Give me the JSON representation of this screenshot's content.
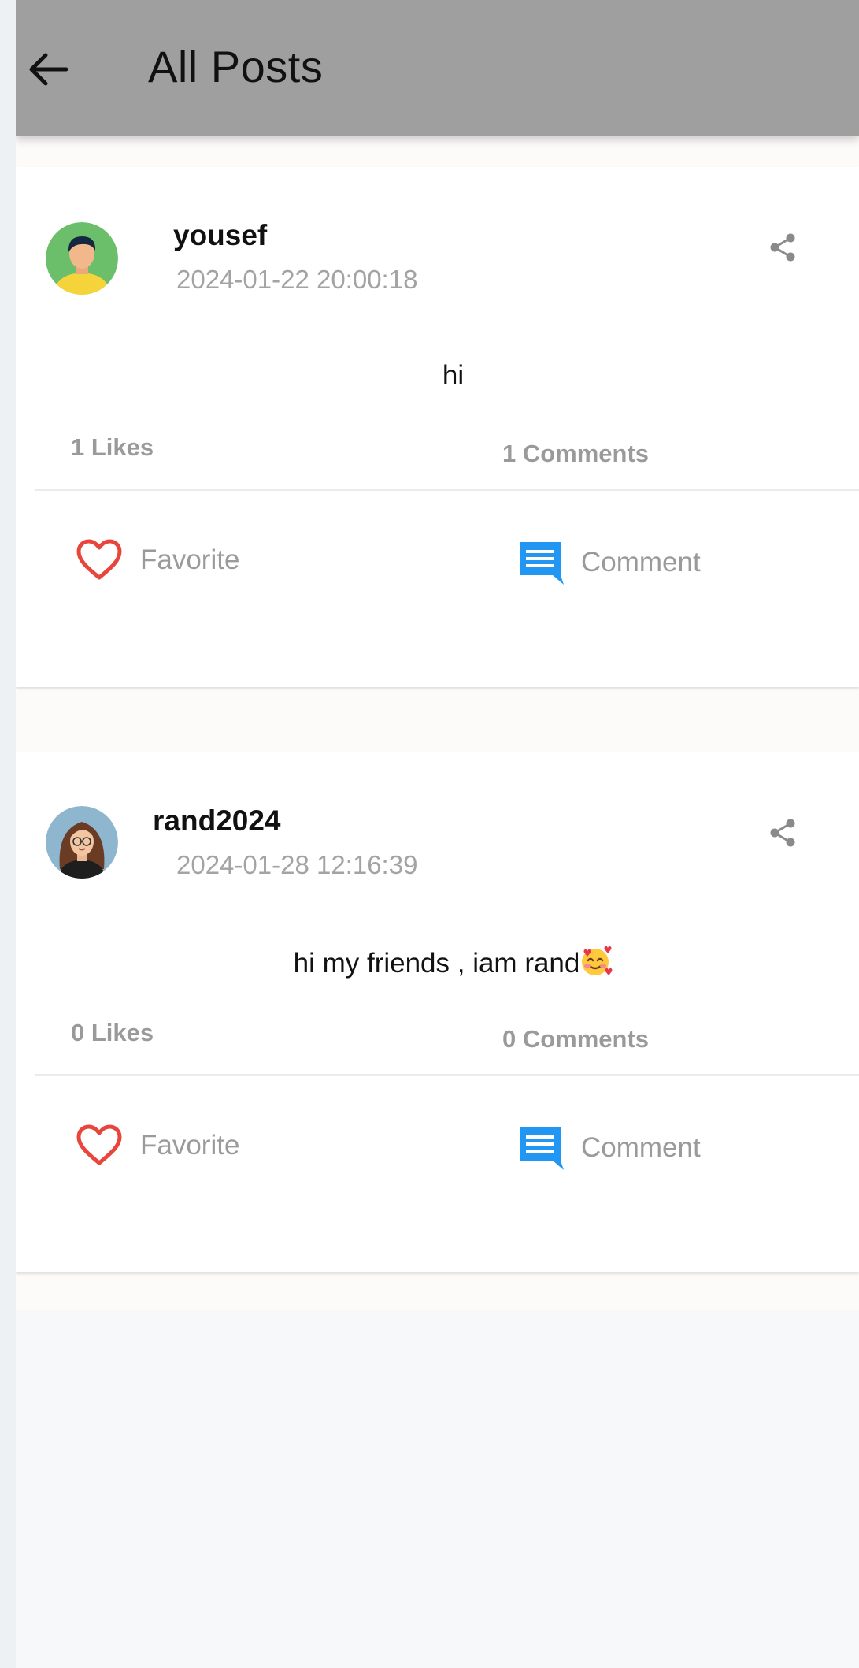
{
  "app_bar": {
    "title": "All Posts",
    "back_icon": "arrow-left-icon",
    "background": "#9f9f9f"
  },
  "posts": [
    {
      "username": "yousef",
      "timestamp": "2024-01-22 20:00:18",
      "text": "hi",
      "likes_label": "1 Likes",
      "comments_label": "1 Comments",
      "favorite_label": "Favorite",
      "comment_label": "Comment",
      "avatar_icon": "male-avatar-icon",
      "share_icon": "share-icon"
    },
    {
      "username": "rand2024",
      "timestamp": "2024-01-28 12:16:39",
      "text": "hi my friends , iam rand",
      "text_emoji": "smiling-face-with-hearts-emoji",
      "likes_label": "0 Likes",
      "comments_label": "0 Comments",
      "favorite_label": "Favorite",
      "comment_label": "Comment",
      "avatar_icon": "female-avatar-icon",
      "share_icon": "share-icon"
    }
  ],
  "colors": {
    "favorite_heart": "#e8453c",
    "comment_icon": "#2196f3",
    "muted_text": "#9a9a9a"
  }
}
